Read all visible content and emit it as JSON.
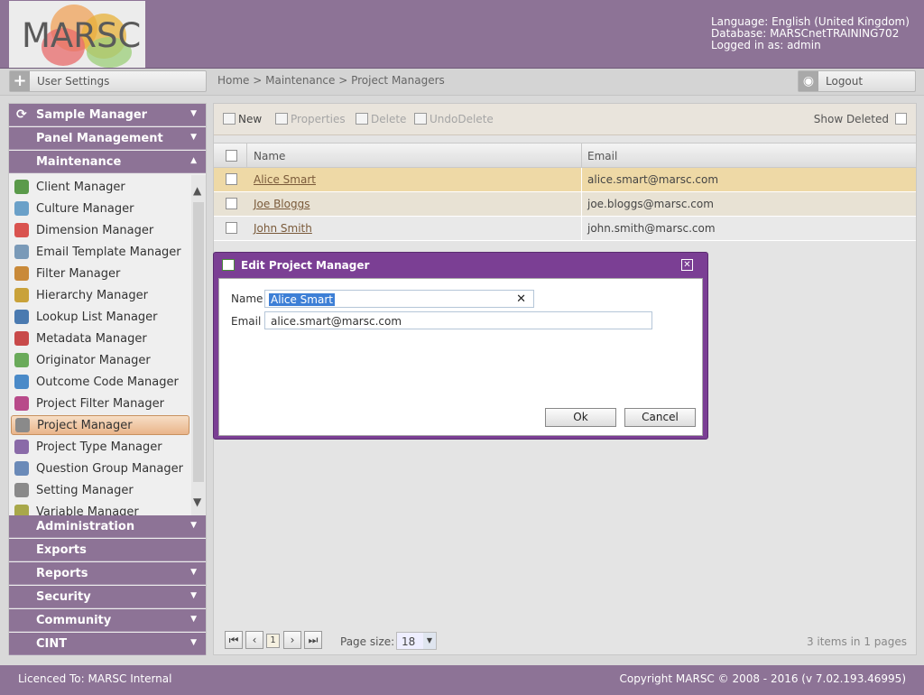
{
  "app": {
    "logo_text": "MARSC"
  },
  "header": {
    "language": "Language: English (United Kingdom)",
    "database": "Database: MARSCnetTRAINING702",
    "logged_in": "Logged in as: admin"
  },
  "topbar": {
    "user_settings": "User Settings",
    "breadcrumb": "Home > Maintenance > Project Managers",
    "logout": "Logout"
  },
  "sidebar": {
    "sections_top": [
      {
        "label": "Sample Manager",
        "expanded": false
      },
      {
        "label": "Panel Management",
        "expanded": false
      },
      {
        "label": "Maintenance",
        "expanded": true
      }
    ],
    "maintenance_items": [
      {
        "label": "Client Manager",
        "icon": "client-icon",
        "color": "#5a9a4a"
      },
      {
        "label": "Culture Manager",
        "icon": "culture-icon",
        "color": "#6aa0c8"
      },
      {
        "label": "Dimension Manager",
        "icon": "dimension-icon",
        "color": "#d9534f"
      },
      {
        "label": "Email Template Manager",
        "icon": "email-template-icon",
        "color": "#7a9ab8"
      },
      {
        "label": "Filter Manager",
        "icon": "filter-icon",
        "color": "#c98a3a"
      },
      {
        "label": "Hierarchy Manager",
        "icon": "hierarchy-icon",
        "color": "#c9a23a"
      },
      {
        "label": "Lookup List Manager",
        "icon": "lookup-icon",
        "color": "#4a7ab0"
      },
      {
        "label": "Metadata Manager",
        "icon": "metadata-icon",
        "color": "#c84a4a"
      },
      {
        "label": "Originator Manager",
        "icon": "originator-icon",
        "color": "#6aaa5a"
      },
      {
        "label": "Outcome Code Manager",
        "icon": "outcome-icon",
        "color": "#4a8ac8"
      },
      {
        "label": "Project Filter Manager",
        "icon": "project-filter-icon",
        "color": "#b84a8a"
      },
      {
        "label": "Project Manager",
        "icon": "project-manager-icon",
        "color": "#8a8a8a",
        "selected": true
      },
      {
        "label": "Project Type Manager",
        "icon": "project-type-icon",
        "color": "#8a6aa8"
      },
      {
        "label": "Question Group Manager",
        "icon": "question-group-icon",
        "color": "#6a8ab8"
      },
      {
        "label": "Setting Manager",
        "icon": "setting-icon",
        "color": "#8a8a8a"
      },
      {
        "label": "Variable Manager",
        "icon": "variable-icon",
        "color": "#a8a84a"
      }
    ],
    "sections_bottom": [
      {
        "label": "Administration",
        "arrow": true
      },
      {
        "label": "Exports",
        "arrow": false
      },
      {
        "label": "Reports",
        "arrow": true
      },
      {
        "label": "Security",
        "arrow": true
      },
      {
        "label": "Community",
        "arrow": true
      },
      {
        "label": "CINT",
        "arrow": true
      }
    ]
  },
  "toolbar": {
    "new": "New",
    "properties": "Properties",
    "delete": "Delete",
    "undo_delete": "UndoDelete",
    "show_deleted": "Show Deleted"
  },
  "grid": {
    "columns": [
      "Name",
      "Email"
    ],
    "rows": [
      {
        "name": "Alice Smart",
        "email": "alice.smart@marsc.com"
      },
      {
        "name": "Joe Bloggs",
        "email": "joe.bloggs@marsc.com"
      },
      {
        "name": "John Smith",
        "email": "john.smith@marsc.com"
      }
    ]
  },
  "pager": {
    "current_page": "1",
    "page_size_label": "Page size:",
    "page_size": "18",
    "items_info": "3 items in 1 pages"
  },
  "dialog": {
    "title": "Edit Project Manager",
    "name_label": "Name",
    "name_value": "Alice Smart",
    "email_label": "Email",
    "email_value": "alice.smart@marsc.com",
    "ok": "Ok",
    "cancel": "Cancel"
  },
  "footer": {
    "licence": "Licenced To: MARSC Internal",
    "copyright": "Copyright MARSC © 2008 - 2016  (v 7.02.193.46995)"
  },
  "colors": {
    "brand": "#8d7396",
    "dialog": "#7b3f94",
    "selected_row": "#eed9a6"
  }
}
